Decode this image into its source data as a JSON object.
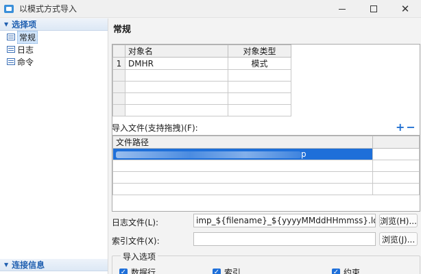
{
  "window": {
    "title": "以模式方式导入"
  },
  "left": {
    "section_options": "选择项",
    "items": [
      {
        "label": "常规",
        "selected": true
      },
      {
        "label": "日志",
        "selected": false
      },
      {
        "label": "命令",
        "selected": false
      }
    ],
    "section_connection": "连接信息"
  },
  "main": {
    "title": "常规",
    "objects_table": {
      "headers": [
        "对象名",
        "对象类型"
      ],
      "rows": [
        {
          "num": "1",
          "name": "DMHR",
          "type": "模式"
        }
      ]
    },
    "import_files_label": "导入文件(支持拖拽)(F):",
    "add_symbol": "+",
    "remove_symbol": "−",
    "files_table": {
      "header": "文件路径",
      "row_end": "p"
    },
    "log_label": "日志文件(L):",
    "log_value": "imp_${filename}_${yyyyMMddHHmmss}.log",
    "log_browse": "浏览(H)...",
    "index_label": "索引文件(X):",
    "index_value": "",
    "index_browse": "浏览(J)...",
    "import_options_title": "导入选项",
    "options": [
      {
        "label": "数据行",
        "checked": true
      },
      {
        "label": "索引",
        "checked": true
      },
      {
        "label": "约束",
        "checked": true
      }
    ]
  },
  "colors": {
    "accent": "#1e6fd9",
    "header_text": "#1f5fb0"
  }
}
